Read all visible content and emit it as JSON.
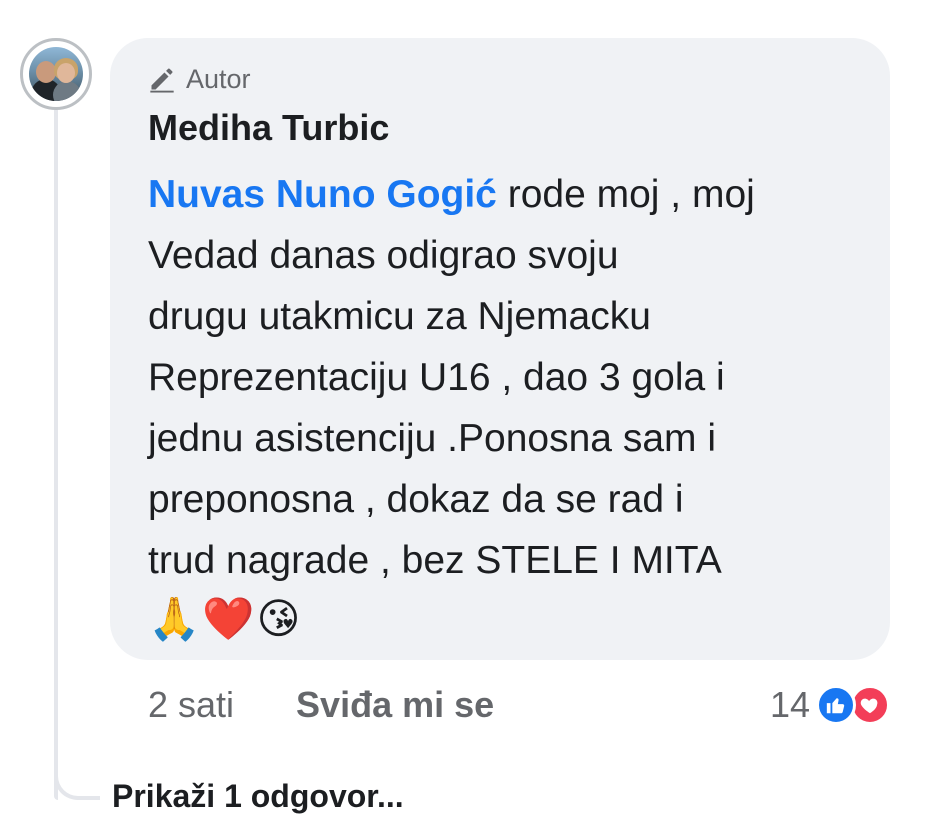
{
  "comment": {
    "badge_label": "Autor",
    "author_name": "Mediha Turbic",
    "mention": "Nuvas Nuno Gogić",
    "body_lines": [
      " rode moj , moj",
      "Vedad danas odigrao svoju",
      "drugu utakmicu za Njemacku",
      "Reprezentaciju U16 , dao 3 gola i",
      "jednu asistenciju .Ponosna sam i",
      "preponosna , dokaz da se rad i",
      "trud nagrade , bez STELE I MITA"
    ],
    "emojis": [
      "🙏",
      "❤️",
      "😘"
    ]
  },
  "actions": {
    "timestamp": "2 sati",
    "like_label": "Sviđa mi se",
    "reaction_count": "14",
    "reaction_icons": [
      "like-icon",
      "love-icon"
    ]
  },
  "replies": {
    "label": "Prikaži 1 odgovor..."
  },
  "colors": {
    "mention": "#1877f2",
    "bubble_bg": "#f0f2f5",
    "secondary_text": "#65676b",
    "like_blue": "#1877f2",
    "love_red": "#f33e58"
  }
}
